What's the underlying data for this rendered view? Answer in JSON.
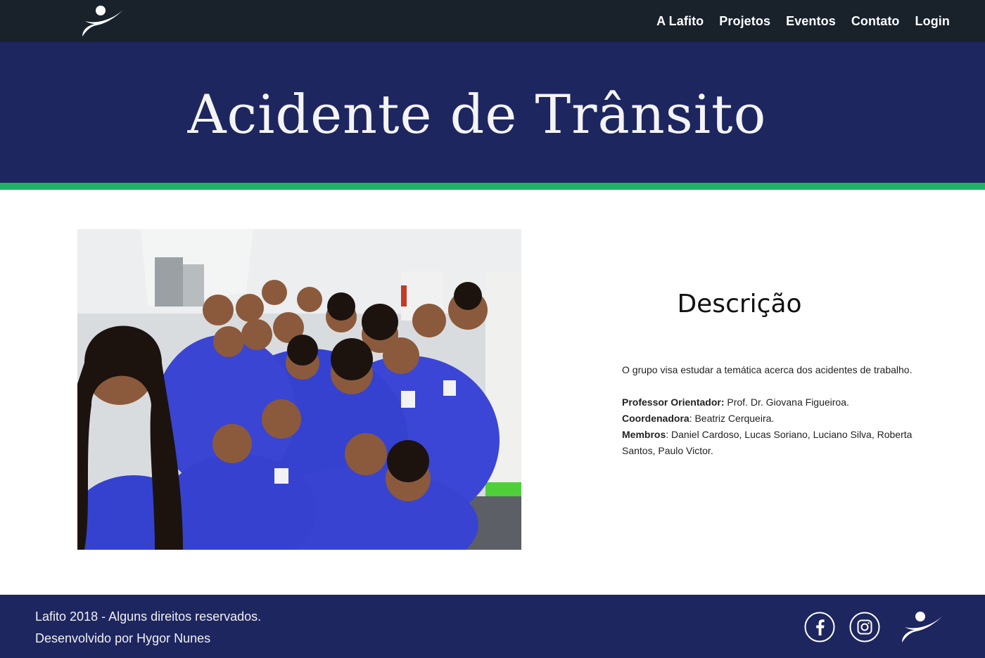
{
  "colors": {
    "nav_bg": "#19212b",
    "hero_bg": "#1e2660",
    "accent_stripe": "#1fb267",
    "footer_bg": "#1e2660",
    "shirt_blue": "#3b46d6"
  },
  "nav": {
    "logo_icon": "lafito-runner-logo-icon",
    "items": [
      {
        "label": "A Lafito"
      },
      {
        "label": "Projetos"
      },
      {
        "label": "Eventos"
      },
      {
        "label": "Contato"
      },
      {
        "label": "Login"
      }
    ]
  },
  "hero": {
    "title": "Acidente de Trânsito"
  },
  "photo": {
    "icon": "group-photo"
  },
  "description": {
    "title": "Descrição",
    "intro": "O grupo visa estudar a temática acerca dos acidentes de trabalho.",
    "advisor_label": "Professor Orientador:",
    "advisor_value": " Prof. Dr. Giovana Figueiroa.",
    "coordinator_label": "Coordenadora",
    "coordinator_value": ": Beatriz Cerqueira.",
    "members_label": "Membros",
    "members_value": ": Daniel Cardoso, Lucas Soriano, Luciano Silva, Roberta Santos, Paulo Victor."
  },
  "footer": {
    "copyright": "Lafito 2018 - Alguns direitos reservados.",
    "developer": "Desenvolvido por Hygor Nunes",
    "facebook_icon": "facebook-icon",
    "instagram_icon": "instagram-icon",
    "logo_icon": "lafito-runner-logo-icon"
  }
}
